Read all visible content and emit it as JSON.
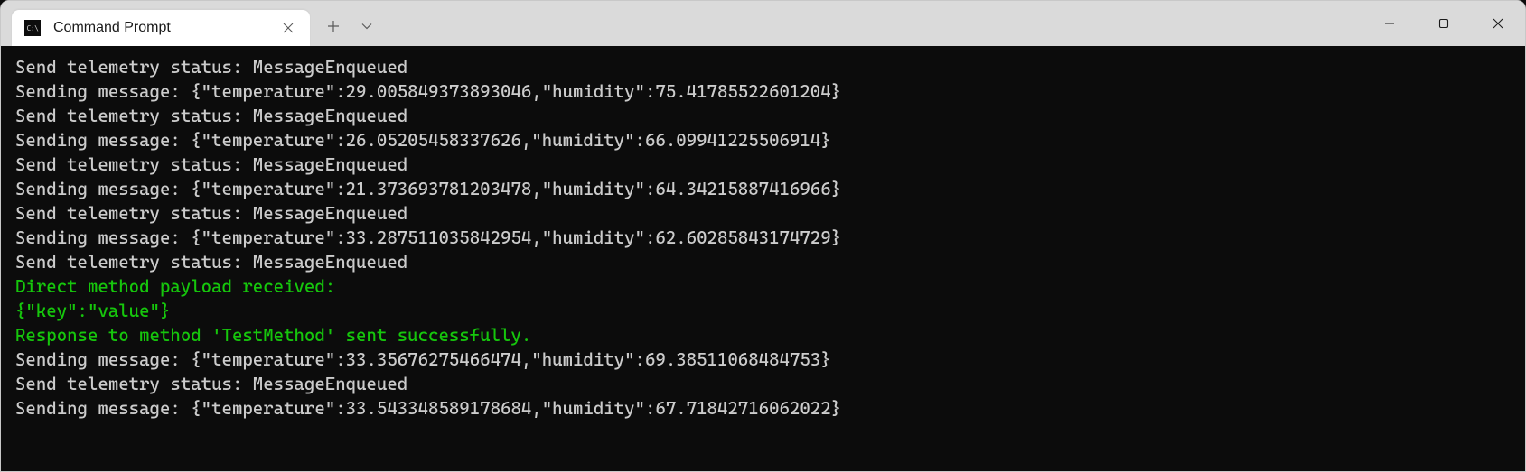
{
  "tab": {
    "title": "Command Prompt"
  },
  "terminal": {
    "lines": [
      {
        "text": "Send telemetry status: MessageEnqueued",
        "color": "default"
      },
      {
        "text": "Sending message: {\"temperature\":29.005849373893046,\"humidity\":75.41785522601204}",
        "color": "default"
      },
      {
        "text": "Send telemetry status: MessageEnqueued",
        "color": "default"
      },
      {
        "text": "Sending message: {\"temperature\":26.05205458337626,\"humidity\":66.09941225506914}",
        "color": "default"
      },
      {
        "text": "Send telemetry status: MessageEnqueued",
        "color": "default"
      },
      {
        "text": "Sending message: {\"temperature\":21.373693781203478,\"humidity\":64.34215887416966}",
        "color": "default"
      },
      {
        "text": "Send telemetry status: MessageEnqueued",
        "color": "default"
      },
      {
        "text": "Sending message: {\"temperature\":33.287511035842954,\"humidity\":62.60285843174729}",
        "color": "default"
      },
      {
        "text": "Send telemetry status: MessageEnqueued",
        "color": "default"
      },
      {
        "text": "Direct method payload received:",
        "color": "green"
      },
      {
        "text": "{\"key\":\"value\"}",
        "color": "green"
      },
      {
        "text": "Response to method 'TestMethod' sent successfully.",
        "color": "green"
      },
      {
        "text": "Sending message: {\"temperature\":33.35676275466474,\"humidity\":69.38511068484753}",
        "color": "default"
      },
      {
        "text": "Send telemetry status: MessageEnqueued",
        "color": "default"
      },
      {
        "text": "Sending message: {\"temperature\":33.543348589178684,\"humidity\":67.71842716062022}",
        "color": "default"
      }
    ]
  }
}
